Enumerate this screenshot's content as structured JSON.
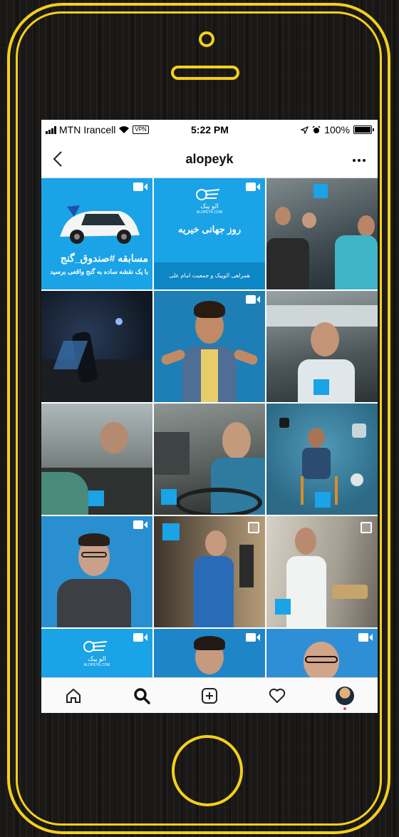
{
  "status_bar": {
    "carrier": "MTN Irancell",
    "vpn_label": "VPN",
    "time": "5:22 PM",
    "battery": "100%"
  },
  "nav": {
    "back_icon": "chevron-left-icon",
    "title": "alopeyk",
    "more_icon": "more-horizontal-icon"
  },
  "posts": [
    {
      "type": "video",
      "headline": "مسابقه #صندوق_گنج",
      "caption": "با یک نقشه ساده به گنج واقعی برسید",
      "bg": "#1aa3e6"
    },
    {
      "type": "video",
      "logo_text": "الو پیک",
      "logo_sub": "ALOPEYK.COM",
      "headline": "روز جهانی خیریه",
      "caption": "همراهی الوپیک و جمعیت امام علی",
      "bg": "#1aa3e6"
    },
    {
      "type": "photo",
      "bg": "#5a6b72"
    },
    {
      "type": "photo",
      "bg": "#1b2433"
    },
    {
      "type": "video",
      "bg": "#1e7fb6"
    },
    {
      "type": "photo",
      "bg": "#6d7878"
    },
    {
      "type": "photo",
      "bg": "#7e8a88"
    },
    {
      "type": "photo",
      "bg": "#59605e"
    },
    {
      "type": "photo",
      "bg": "#3f7a95"
    },
    {
      "type": "video",
      "bg": "#2a8fd0"
    },
    {
      "type": "carousel",
      "bg": "#8a7a62"
    },
    {
      "type": "carousel",
      "bg": "#bfb9ae"
    },
    {
      "type": "video",
      "logo_text": "الو پیک",
      "logo_sub": "ALOPEYK.COM",
      "bg": "#1aa3e6"
    },
    {
      "type": "video",
      "bg": "#1e86c8"
    },
    {
      "type": "video",
      "bg": "#2f8fd6"
    }
  ],
  "tabbar": {
    "items": [
      "home-icon",
      "search-icon",
      "add-post-icon",
      "activity-heart-icon",
      "profile-avatar"
    ],
    "active": "search-icon"
  },
  "colors": {
    "frame": "#f4cf1c",
    "brand_blue": "#1aa3e6"
  }
}
